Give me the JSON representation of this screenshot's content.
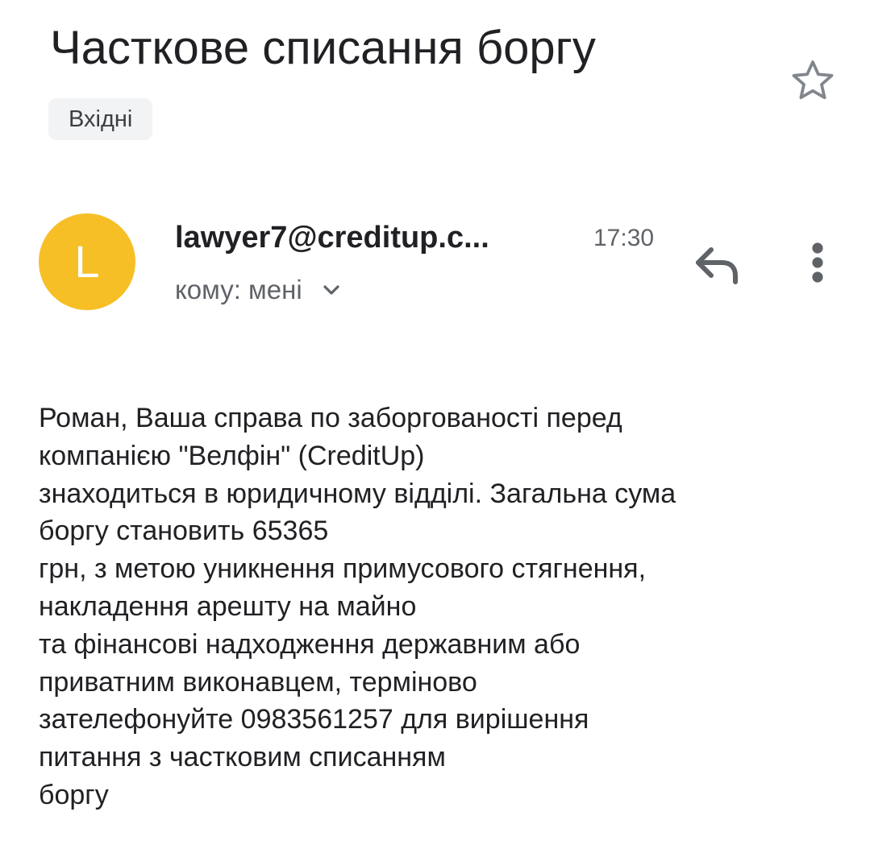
{
  "email": {
    "subject": "Часткове списання боргу",
    "label": "Вхідні",
    "avatar_letter": "L",
    "avatar_color": "#f6bf26",
    "sender": "lawyer7@creditup.c...",
    "time": "17:30",
    "recipient_text": "кому: мені",
    "body_lines": [
      "Роман, Ваша справа по заборгованості перед",
      "компанією \"Велфін\" (CreditUp)",
      "знаходиться в юридичному відділі. Загальна сума",
      "боргу становить 65365",
      "грн, з метою уникнення примусового стягнення,",
      "накладення арешту на майно",
      "та фінансові надходження державним або",
      "приватним виконавцем, терміново",
      "зателефонуйте 0983561257 для вирішення",
      "питання з частковим списанням",
      "боргу"
    ]
  },
  "icons": {
    "star": "star-outline-icon",
    "reply": "reply-icon",
    "more": "more-vert-icon",
    "expand": "chevron-down-icon"
  }
}
